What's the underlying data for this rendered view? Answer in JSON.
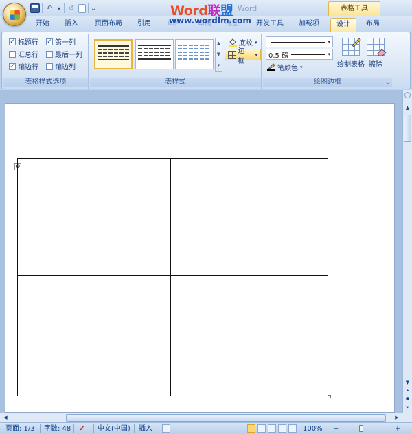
{
  "title_bar": {
    "watermark": {
      "part1": "Word",
      "part2": "联",
      "part3": "盟"
    },
    "watermark_url": "www.wordlm.com",
    "ghost_title": "Word",
    "contextual_tab_group": "表格工具",
    "qat": {
      "undo_arrow": "▾",
      "customize": "⌄"
    }
  },
  "tabs": [
    "开始",
    "插入",
    "页面布局",
    "引用",
    "邮件",
    "审阅",
    "视图",
    "开发工具",
    "加载项",
    "设计",
    "布局"
  ],
  "active_tab": "设计",
  "ribbon": {
    "group_table_style_options": {
      "label": "表格样式选项",
      "options": [
        {
          "label": "标题行",
          "checked": true
        },
        {
          "label": "第一列",
          "checked": true
        },
        {
          "label": "汇总行",
          "checked": false
        },
        {
          "label": "最后一列",
          "checked": false
        },
        {
          "label": "镶边行",
          "checked": true
        },
        {
          "label": "镶边列",
          "checked": false
        }
      ],
      "check_mark": "✓"
    },
    "group_table_styles": {
      "label": "表样式",
      "shading_label": "底纹",
      "borders_label": "边框",
      "dropdown_arrow": "▾",
      "scroll": [
        "▲",
        "▼",
        "▾"
      ]
    },
    "group_draw_borders": {
      "label": "绘图边框",
      "line_weight": "0.5 磅",
      "pen_color_label": "笔颜色",
      "draw_table_label": "绘制表格",
      "eraser_label": "擦除",
      "dropdown_arrow": "▾",
      "launcher": "↘"
    }
  },
  "document": {
    "move_handle_glyph": "✥"
  },
  "scrollbars": {
    "up": "▲",
    "down": "▼",
    "left": "◀",
    "right": "▶",
    "prev_page": "⏶",
    "next_page": "⏷",
    "browse": "●"
  },
  "status_bar": {
    "page": "页面: 1/3",
    "words": "字数: 48",
    "language": "中文(中国)",
    "mode": "插入",
    "zoom": "100%",
    "zoom_minus": "−",
    "zoom_plus": "+"
  },
  "colors": {
    "accent": "#fbd872",
    "ribbon_text": "#15428b",
    "watermark_word": "#e8502a",
    "watermark_cn": "#c22bbf"
  }
}
